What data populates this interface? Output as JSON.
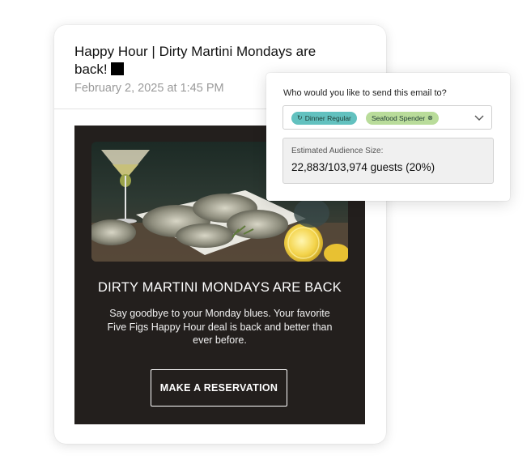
{
  "email": {
    "subject": "Happy Hour | Dirty Martini Mondays are back!",
    "sent_at": "February 2, 2025 at 1:45 PM",
    "body": {
      "headline": "DIRTY MARTINI MONDAYS ARE BACK",
      "text": "Say goodbye to your Monday blues. Your favorite Five Figs Happy Hour deal is back and better than ever before.",
      "cta_label": "MAKE A RESERVATION",
      "background_color": "#231f1d"
    }
  },
  "audience": {
    "question": "Who would you like to send this email to?",
    "tags": [
      {
        "label": "Dinner Regular",
        "icon": "refresh-icon",
        "color": "#62c1bf"
      },
      {
        "label": "Seafood Spender",
        "icon": "remove-circle-icon",
        "color": "#b9dc9a"
      }
    ],
    "dropdown_icon": "chevron-down-icon",
    "estimate_label": "Estimated Audience Size:",
    "estimate_value": "22,883/103,974 guests (20%)"
  }
}
